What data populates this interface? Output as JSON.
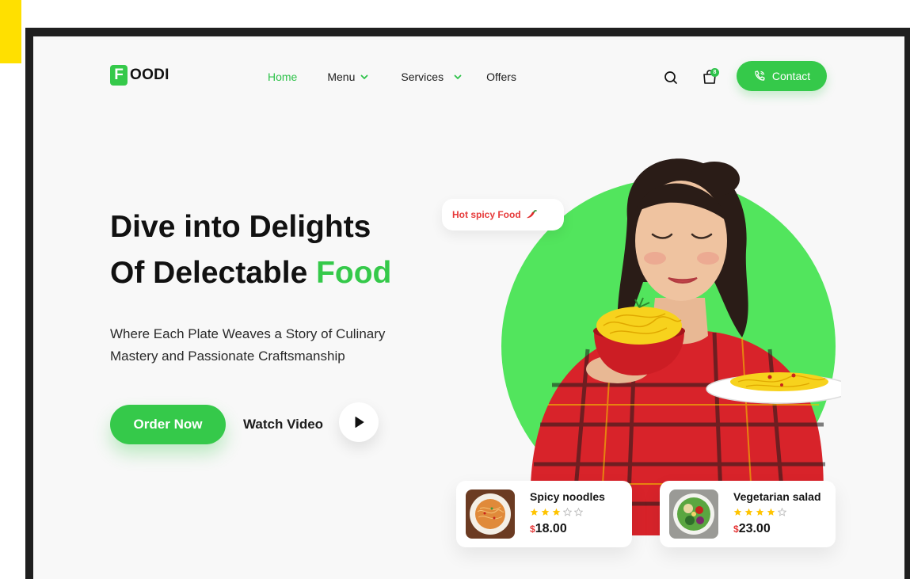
{
  "brand": {
    "logo_letter": "F",
    "logo_text": "OODI",
    "accent": "#35c94a",
    "accent_light": "#52e55d"
  },
  "nav": {
    "home": "Home",
    "menu": "Menu",
    "services": "Services",
    "offers": "Offers"
  },
  "header": {
    "search_icon": "search-icon",
    "cart_icon": "shopping-bag-icon",
    "cart_count": "8",
    "contact_label": "Contact",
    "contact_icon": "phone-icon"
  },
  "hero": {
    "headline_line1": "Dive into Delights",
    "headline_line2_prefix": "Of Delectable ",
    "headline_line2_accent": "Food",
    "subtext": "Where Each Plate Weaves a Story of Culinary Mastery and Passionate Craftsmanship",
    "order_label": "Order Now",
    "watch_label": "Watch Video",
    "spicy_tag": "Hot spicy Food"
  },
  "products": [
    {
      "name": "Spicy noodles",
      "rating": 3,
      "max_rating": 5,
      "currency": "$",
      "price": "18.00"
    },
    {
      "name": "Vegetarian salad",
      "rating": 4,
      "max_rating": 5,
      "currency": "$",
      "price": "23.00"
    }
  ],
  "colors": {
    "price_currency": "#e63a3a",
    "star": "#ffc400",
    "star_empty": "#b8b8b8"
  }
}
